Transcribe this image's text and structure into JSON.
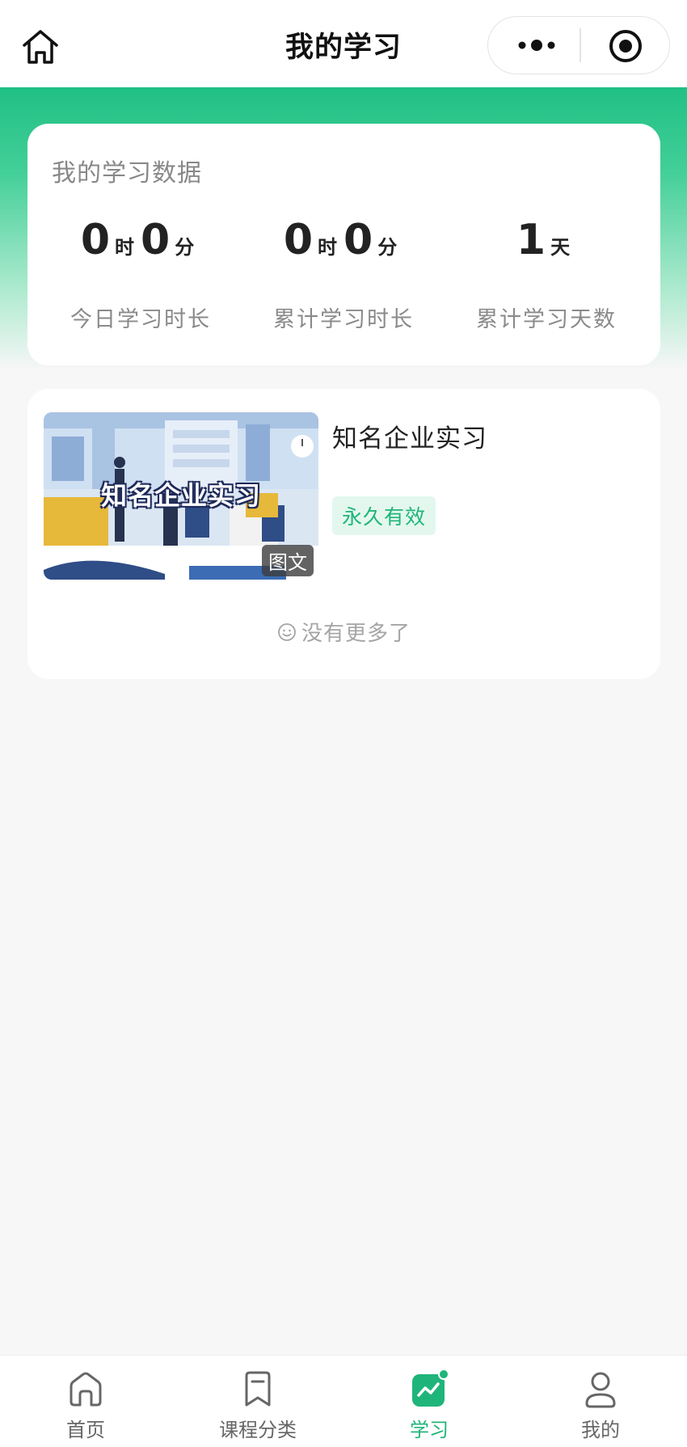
{
  "nav": {
    "title": "我的学习",
    "home_icon": "home-icon",
    "more_icon": "more-dots-icon",
    "target_icon": "circle-target-icon"
  },
  "stats": {
    "title": "我的学习数据",
    "items": [
      {
        "parts": [
          {
            "num": "0",
            "unit": "时"
          },
          {
            "num": "0",
            "unit": "分"
          }
        ],
        "label": "今日学习时长"
      },
      {
        "parts": [
          {
            "num": "0",
            "unit": "时"
          },
          {
            "num": "0",
            "unit": "分"
          }
        ],
        "label": "累计学习时长"
      },
      {
        "parts": [
          {
            "num": "1",
            "unit": "天"
          }
        ],
        "label": "累计学习天数"
      }
    ]
  },
  "course": {
    "thumb_title": "知名企业实习",
    "type_badge": "图文",
    "name": "知名企业实习",
    "validity": "永久有效"
  },
  "footer": {
    "no_more": "没有更多了",
    "icon": "smile-icon"
  },
  "tabbar": {
    "items": [
      {
        "label": "首页",
        "icon": "home-tab-icon",
        "active": false
      },
      {
        "label": "课程分类",
        "icon": "bookmark-tab-icon",
        "active": false
      },
      {
        "label": "学习",
        "icon": "learning-chart-icon",
        "active": true
      },
      {
        "label": "我的",
        "icon": "user-tab-icon",
        "active": false
      }
    ]
  },
  "colors": {
    "accent": "#1fb57a",
    "accent_light": "#e3f7ee",
    "gradient_top": "#20c083"
  }
}
